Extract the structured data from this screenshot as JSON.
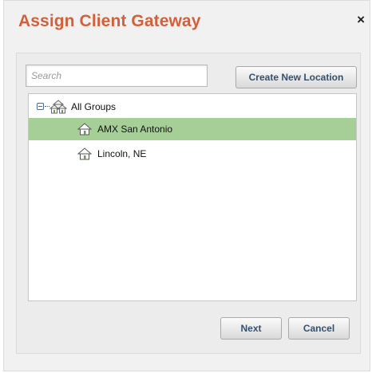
{
  "dialog": {
    "title": "Assign Client Gateway",
    "close_glyph": "×",
    "accent_color": "#d2603a"
  },
  "search": {
    "placeholder": "Search",
    "value": ""
  },
  "toolbar": {
    "create_label": "Create New Location"
  },
  "tree": {
    "root": {
      "label": "All Groups",
      "icon": "group-houses-icon",
      "expanded": true
    },
    "items": [
      {
        "label": "AMX San Antonio",
        "icon": "house-icon",
        "selected": true
      },
      {
        "label": "Lincoln, NE",
        "icon": "house-icon",
        "selected": false
      }
    ],
    "selected_color": "#a6cf98"
  },
  "footer": {
    "next_label": "Next",
    "cancel_label": "Cancel"
  }
}
